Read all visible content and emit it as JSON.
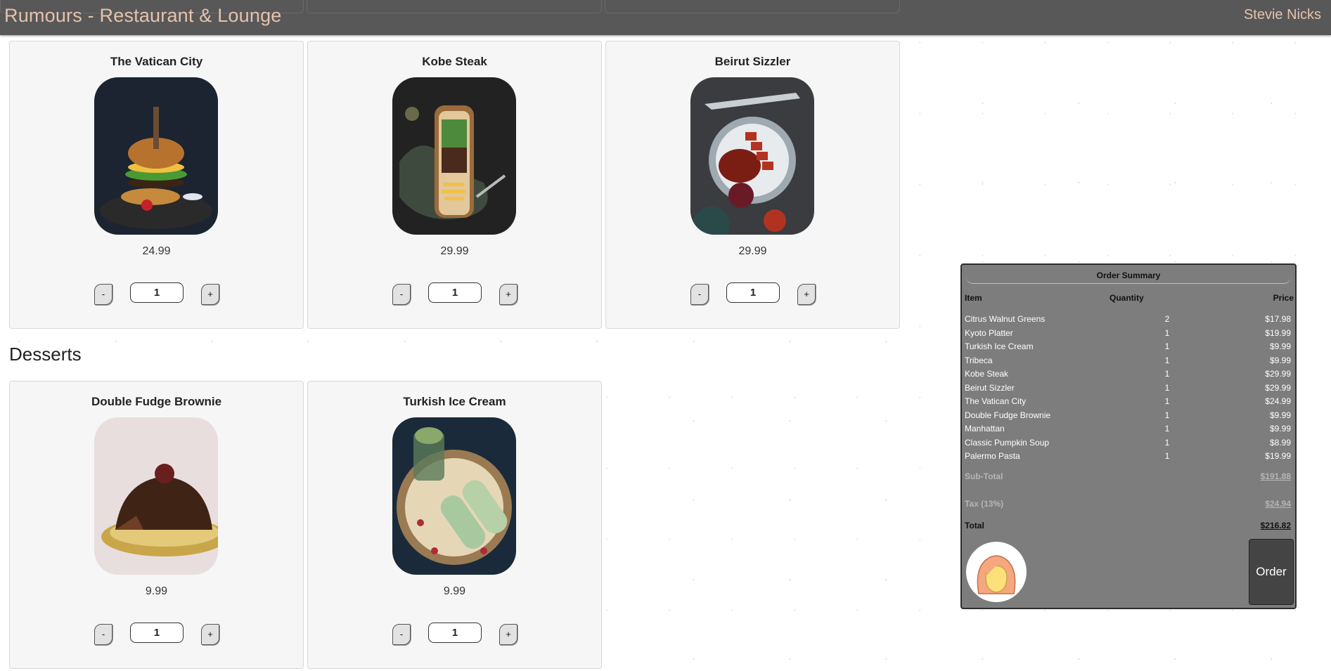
{
  "header": {
    "brand": "Rumours - Restaurant & Lounge",
    "user": "Stevie Nicks"
  },
  "mains": [
    {
      "name": "The Vatican City",
      "price": "24.99",
      "qty": "1"
    },
    {
      "name": "Kobe Steak",
      "price": "29.99",
      "qty": "1"
    },
    {
      "name": "Beirut Sizzler",
      "price": "29.99",
      "qty": "1"
    }
  ],
  "desserts_title": "Desserts",
  "desserts": [
    {
      "name": "Double Fudge Brownie",
      "price": "9.99",
      "qty": "1"
    },
    {
      "name": "Turkish Ice Cream",
      "price": "9.99",
      "qty": "1"
    }
  ],
  "stepper": {
    "minus": "-",
    "plus": "+"
  },
  "summary": {
    "title": "Order Summary",
    "columns": {
      "item": "Item",
      "quantity": "Quantity",
      "price": "Price"
    },
    "rows": [
      {
        "item": "Citrus Walnut Greens",
        "qty": "2",
        "price": "$17.98"
      },
      {
        "item": "Kyoto Platter",
        "qty": "1",
        "price": "$19.99"
      },
      {
        "item": "Turkish Ice Cream",
        "qty": "1",
        "price": "$9.99"
      },
      {
        "item": "Tribeca",
        "qty": "1",
        "price": "$9.99"
      },
      {
        "item": "Kobe Steak",
        "qty": "1",
        "price": "$29.99"
      },
      {
        "item": "Beirut Sizzler",
        "qty": "1",
        "price": "$29.99"
      },
      {
        "item": "The Vatican City",
        "qty": "1",
        "price": "$24.99"
      },
      {
        "item": "Double Fudge Brownie",
        "qty": "1",
        "price": "$9.99"
      },
      {
        "item": "Manhattan",
        "qty": "1",
        "price": "$9.99"
      },
      {
        "item": "Classic Pumpkin Soup",
        "qty": "1",
        "price": "$8.99"
      },
      {
        "item": "Palermo Pasta",
        "qty": "1",
        "price": "$19.99"
      }
    ],
    "subtotal_label": "Sub-Total",
    "subtotal": "$191.88",
    "tax_label": "Tax (13%)",
    "tax": "$24.94",
    "total_label": "Total",
    "total": "$216.82",
    "order_label": "Order"
  },
  "colors": {
    "accent": "#e6c2ad",
    "header_bg": "#585858",
    "summary_bg": "#7d7d7d"
  }
}
